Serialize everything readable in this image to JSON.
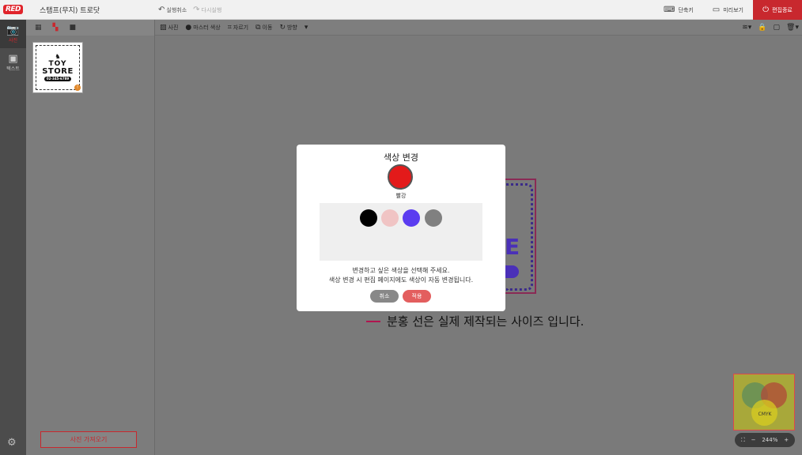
{
  "app": {
    "logo_text": "RED",
    "document_title": "스탬프(무지) 트로닷"
  },
  "history": {
    "undo_label": "실행취소",
    "redo_label": "다시실행"
  },
  "top_actions": {
    "shortcuts_label": "단축키",
    "preview_label": "미리보기",
    "done_label": "편집종료"
  },
  "rail": {
    "items": [
      {
        "label": "사진"
      },
      {
        "label": "텍스트"
      }
    ]
  },
  "panel": {
    "import_button_label": "사진 가져오기",
    "thumbnail": {
      "line1": "TOY",
      "line2": "STORE",
      "phone": "02-345-6789",
      "badge": "!"
    }
  },
  "toolbar": {
    "items": [
      {
        "label": "사진"
      },
      {
        "label": "마스터 색상"
      },
      {
        "label": "자르기"
      },
      {
        "label": "이동"
      },
      {
        "label": "방향"
      }
    ]
  },
  "canvas": {
    "size_note": "분홍 선은 실제 제작되는 사이즈 입니다.",
    "stamp_letter": "E"
  },
  "minimap": {
    "label": "CMYK"
  },
  "zoom": {
    "minus": "−",
    "value": "244%",
    "plus": "+"
  },
  "dialog": {
    "title": "색상 변경",
    "current_color": {
      "name": "빨강",
      "hex": "#e31a1a"
    },
    "palette": [
      {
        "hex": "#000000"
      },
      {
        "hex": "#f0c4c4"
      },
      {
        "hex": "#5b3cf0"
      },
      {
        "hex": "#808080"
      }
    ],
    "message_line1": "변경하고 싶은 색상을 선택해 주세요.",
    "message_line2": "색상 변경 시 편집 페이지에도 색상이 자동 변경됩니다.",
    "cancel_label": "취소",
    "apply_label": "적용"
  }
}
